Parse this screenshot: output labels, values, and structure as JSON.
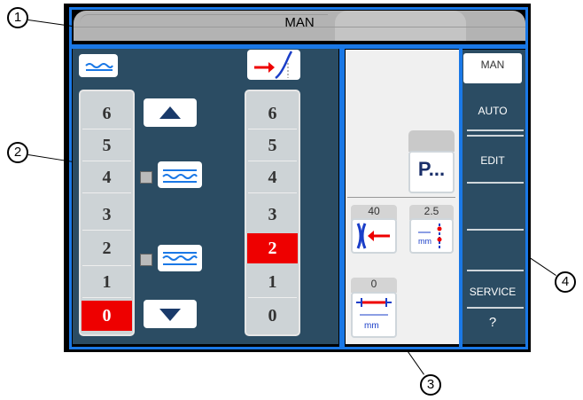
{
  "header": {
    "mode": "MAN"
  },
  "left_panel": {
    "left_column": {
      "levels": [
        "6",
        "5",
        "4",
        "3",
        "2",
        "1",
        "0"
      ],
      "active": "0"
    },
    "right_column": {
      "levels": [
        "6",
        "5",
        "4",
        "3",
        "2",
        "1",
        "0"
      ],
      "active": "2"
    }
  },
  "middle_panel": {
    "program_button": "P...",
    "values": {
      "a": "40",
      "b": "2.5",
      "c": "0"
    },
    "unit": "mm"
  },
  "sidebar": {
    "items": [
      {
        "label": "MAN",
        "selected": true
      },
      {
        "label": "AUTO"
      },
      {
        "label": "EDIT"
      },
      {
        "label": ""
      },
      {
        "label": ""
      },
      {
        "label": "SERVICE"
      },
      {
        "label": "?"
      }
    ]
  },
  "callouts": [
    "1",
    "2",
    "3",
    "4"
  ],
  "colors": {
    "frame_blue": "#1a78e6",
    "panel": "#2b4c63",
    "active_red": "#e00000"
  }
}
